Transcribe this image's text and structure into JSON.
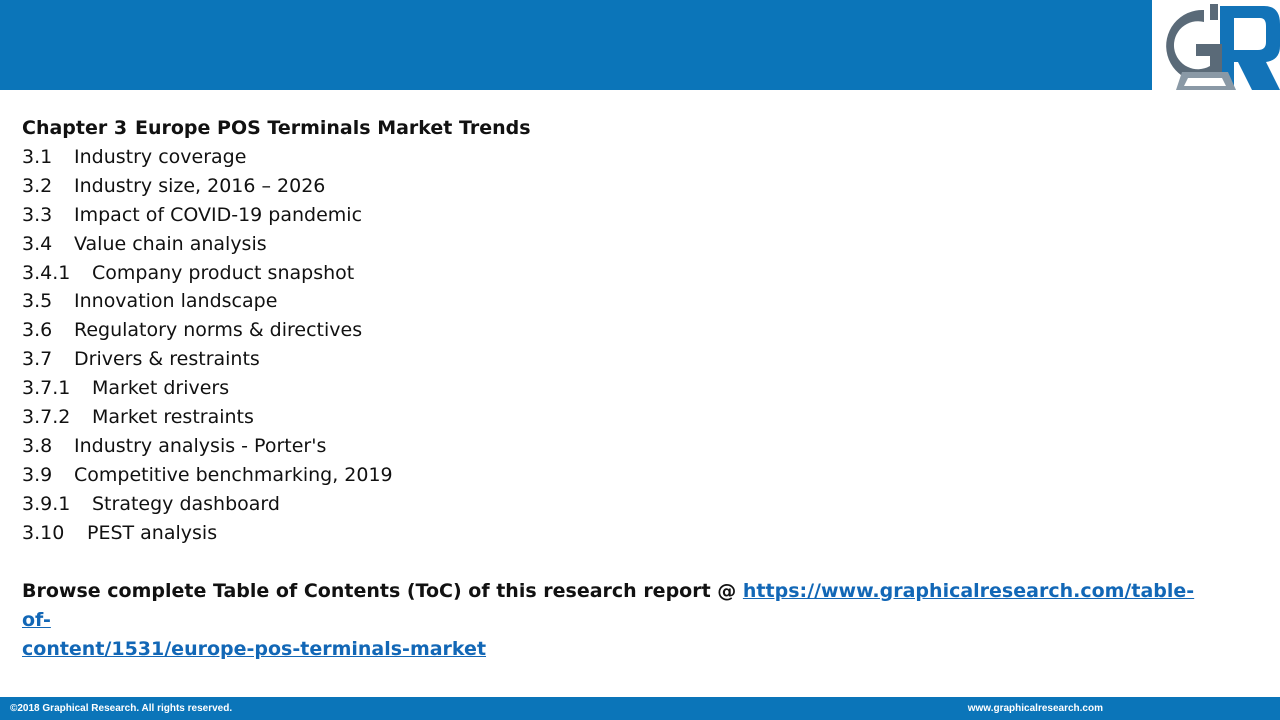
{
  "header": {
    "logo_icon": "graphical-research-gr-logo",
    "brand_color": "#0b75b9"
  },
  "toc": {
    "chapter_number": "Chapter 3",
    "chapter_title": "Europe POS Terminals Market Trends",
    "items": [
      {
        "num": "3.1",
        "label": "Industry coverage"
      },
      {
        "num": "3.2",
        "label": "Industry size, 2016 – 2026"
      },
      {
        "num": "3.3",
        "label": "Impact of COVID-19 pandemic"
      },
      {
        "num": "3.4",
        "label": "Value chain analysis"
      },
      {
        "num": "3.4.1",
        "label": "Company product snapshot"
      },
      {
        "num": "3.5",
        "label": "Innovation landscape"
      },
      {
        "num": "3.6",
        "label": "Regulatory norms & directives"
      },
      {
        "num": "3.7",
        "label": "Drivers & restraints"
      },
      {
        "num": "3.7.1",
        "label": "Market drivers"
      },
      {
        "num": "3.7.2",
        "label": "Market restraints"
      },
      {
        "num": "3.8",
        "label": "Industry analysis - Porter's"
      },
      {
        "num": "3.9",
        "label": "Competitive benchmarking, 2019"
      },
      {
        "num": "3.9.1",
        "label": "Strategy dashboard"
      },
      {
        "num": "3.10",
        "label": "PEST analysis"
      }
    ]
  },
  "browse": {
    "text": "Browse complete Table of Contents (ToC) of this research report @ ",
    "link_text_line1": "https://www.graphicalresearch.com/table-of-",
    "link_text_line2": "content/1531/europe-pos-terminals-market",
    "link_color": "#1267b6"
  },
  "footer": {
    "copyright": "©2018 Graphical Research. All rights reserved.",
    "website": "www.graphicalresearch.com"
  }
}
